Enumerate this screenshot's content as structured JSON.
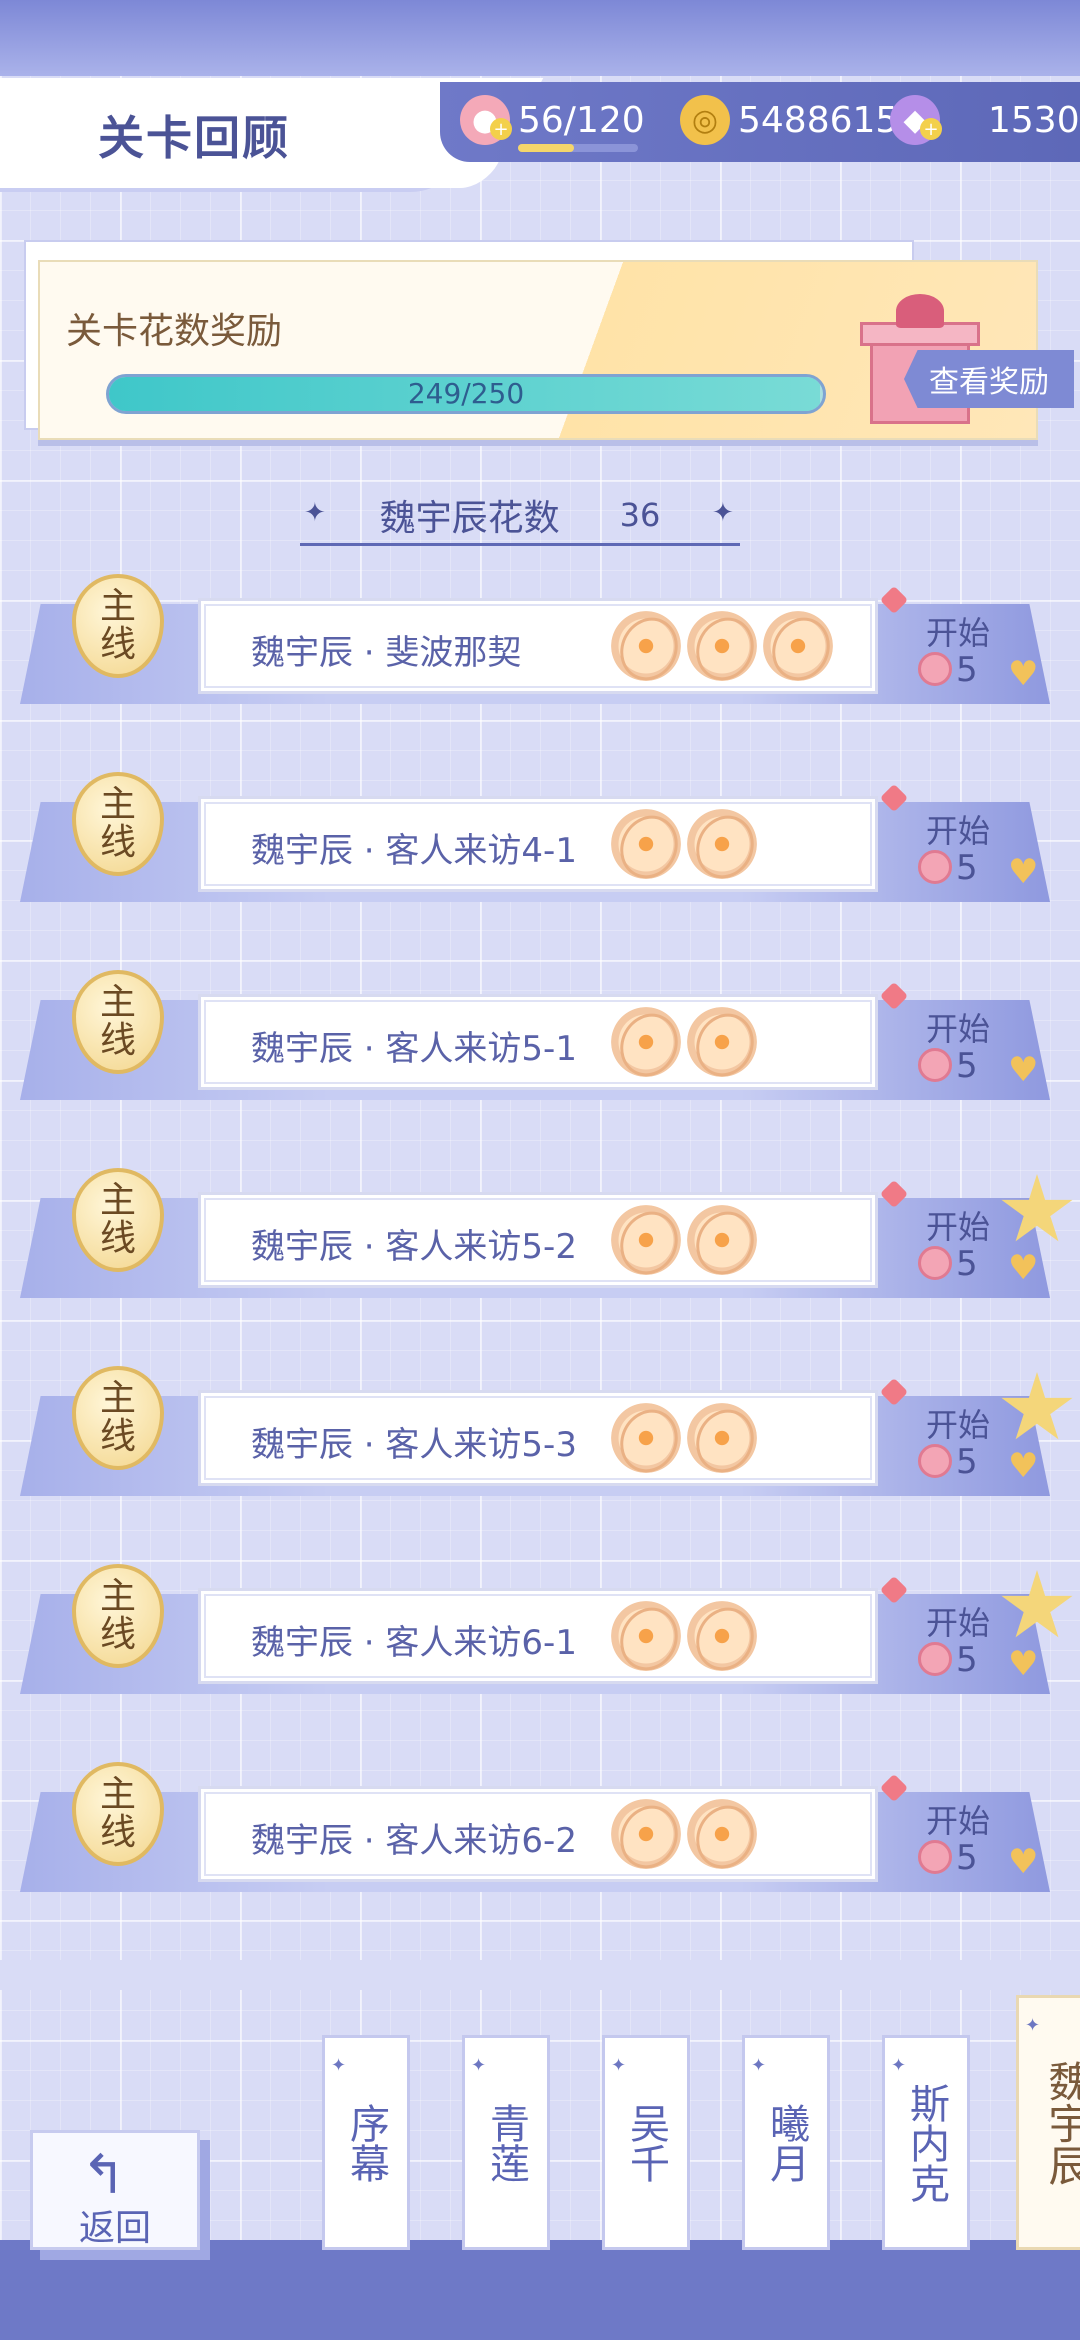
{
  "header": {
    "title": "关卡回顾",
    "resources": [
      {
        "icon": "cupcake-stamina-icon",
        "value": "56/120"
      },
      {
        "icon": "gold-coin-icon",
        "value": "5488615"
      },
      {
        "icon": "crystal-gem-icon",
        "value": "1530"
      }
    ]
  },
  "reward": {
    "label": "关卡花数奖励",
    "progress_text": "249/250",
    "progress_value": 0.996,
    "view_button": "查看奖励"
  },
  "section": {
    "title": "魏宇辰花数",
    "count": "36"
  },
  "levels": [
    {
      "badge": [
        "主",
        "线"
      ],
      "name": "魏宇辰 · 斐波那契",
      "flowers": 3,
      "start": "开始",
      "cost": "5",
      "emblem": false
    },
    {
      "badge": [
        "主",
        "线"
      ],
      "name": "魏宇辰 · 客人来访4-1",
      "flowers": 2,
      "start": "开始",
      "cost": "5",
      "emblem": false
    },
    {
      "badge": [
        "主",
        "线"
      ],
      "name": "魏宇辰 · 客人来访5-1",
      "flowers": 2,
      "start": "开始",
      "cost": "5",
      "emblem": false
    },
    {
      "badge": [
        "主",
        "线"
      ],
      "name": "魏宇辰 · 客人来访5-2",
      "flowers": 2,
      "start": "开始",
      "cost": "5",
      "emblem": true
    },
    {
      "badge": [
        "主",
        "线"
      ],
      "name": "魏宇辰 · 客人来访5-3",
      "flowers": 2,
      "start": "开始",
      "cost": "5",
      "emblem": true
    },
    {
      "badge": [
        "主",
        "线"
      ],
      "name": "魏宇辰 · 客人来访6-1",
      "flowers": 2,
      "start": "开始",
      "cost": "5",
      "emblem": true
    },
    {
      "badge": [
        "主",
        "线"
      ],
      "name": "魏宇辰 · 客人来访6-2",
      "flowers": 2,
      "start": "开始",
      "cost": "5",
      "emblem": false
    }
  ],
  "footer": {
    "back_label": "返回",
    "tabs": [
      {
        "label": "序幕",
        "active": false
      },
      {
        "label": "青莲",
        "active": false
      },
      {
        "label": "吴千",
        "active": false
      },
      {
        "label": "曦月",
        "active": false
      },
      {
        "label": "斯内克",
        "active": false
      },
      {
        "label": "魏宇辰",
        "active": true
      }
    ]
  },
  "colors": {
    "accent": "#5f69b5",
    "gold": "#f2c14b",
    "progress": "#3fc7c9"
  }
}
